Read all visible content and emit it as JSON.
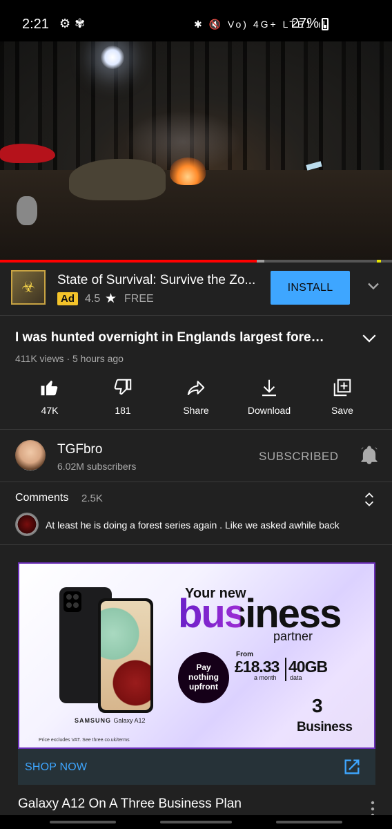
{
  "status_bar": {
    "time": "2:21",
    "left_icons": [
      "settings-cog-icon",
      "fan-icon"
    ],
    "right_icons_text": "✱ 🔇 Vo) 4G+ LTE1 ıll",
    "battery": "27%"
  },
  "video": {
    "progress_fraction": 0.655,
    "buffered_fraction": 0.02
  },
  "ad": {
    "title": "State of Survival: Survive the Zo...",
    "badge": "Ad",
    "rating": "4.5",
    "star": "★",
    "price": "FREE",
    "install_label": "INSTALL"
  },
  "video_info": {
    "title": "I was hunted overnight in Englands largest forest...",
    "meta": "411K views · 5 hours ago"
  },
  "actions": [
    {
      "label": "47K",
      "icon": "thumbs-up-icon"
    },
    {
      "label": "181",
      "icon": "thumbs-down-icon"
    },
    {
      "label": "Share",
      "icon": "share-icon"
    },
    {
      "label": "Download",
      "icon": "download-icon"
    },
    {
      "label": "Save",
      "icon": "save-to-playlist-icon"
    }
  ],
  "channel": {
    "name": "TGFbro",
    "subscribers": "6.02M subscribers",
    "subscribed_label": "SUBSCRIBED"
  },
  "comments": {
    "heading": "Comments",
    "count": "2.5K",
    "top_comment": "At least he is doing a forest series again . Like we asked awhile back"
  },
  "banner_ad": {
    "your_new": "Your new",
    "business_word": "business",
    "partner": "partner",
    "pay_line1": "Pay",
    "pay_line2": "nothing",
    "pay_line3": "upfront",
    "from": "From",
    "price": "£18.33",
    "per_month": "a month",
    "data_amount": "40GB",
    "data_word": "data",
    "brand_logo": "3",
    "brand_name": "Business",
    "phone_brand": "SAMSUNG",
    "phone_model": "Galaxy A12",
    "fine_print": "Price excludes VAT. See three.co.uk/terms",
    "cta": "SHOP NOW"
  },
  "next_title": "Galaxy A12 On A Three Business Plan",
  "colors": {
    "background": "#212121",
    "accent_blue": "#3ea6ff",
    "progress_red": "#ff0000",
    "ad_badge": "#f3c32a"
  }
}
